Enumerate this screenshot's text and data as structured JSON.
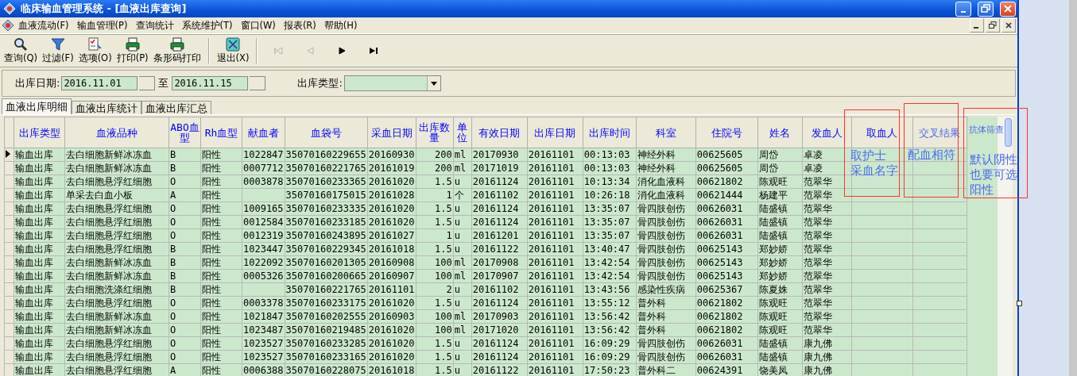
{
  "window": {
    "title": "临床输血管理系统 - [血液出库查询]"
  },
  "menu": [
    "血液流动(F)",
    "输血管理(P)",
    "查询统计",
    "系统维护(T)",
    "窗口(W)",
    "报表(R)",
    "帮助(H)"
  ],
  "toolbar": [
    {
      "kind": "search",
      "label": "查询(Q)"
    },
    {
      "kind": "filter",
      "label": "过滤(F)"
    },
    {
      "kind": "options",
      "label": "选项(O)"
    },
    {
      "kind": "print",
      "label": "打印(P)"
    },
    {
      "kind": "print",
      "label": "条形码打印"
    },
    {
      "kind": "exit",
      "label": "退出(X)"
    }
  ],
  "navigation": [
    {
      "kind": "first",
      "disabled": true
    },
    {
      "kind": "prev",
      "disabled": true
    },
    {
      "kind": "next",
      "disabled": false
    },
    {
      "kind": "last",
      "disabled": false
    }
  ],
  "filter": {
    "date_label": "出库日期:",
    "date_from": "2016.11.01",
    "date_to_label": "至",
    "date_to": "2016.11.15",
    "type_label": "出库类型:"
  },
  "tabs": [
    {
      "label": "血液出库明细",
      "selected": true
    },
    {
      "label": "血液出库统计",
      "selected": false
    },
    {
      "label": "血液出库汇总",
      "selected": false
    }
  ],
  "table": {
    "columns": [
      "出库类型",
      "血液品种",
      "ABO血型",
      "Rh血型",
      "献血者",
      "血袋号",
      "采血日期",
      "出库数量",
      "单位",
      "有效日期",
      "出库日期",
      "出库时间",
      "科室",
      "住院号",
      "姓名",
      "发血人",
      "取血人",
      "交叉结果"
    ],
    "rows": [
      {
        "selected": true,
        "cells": [
          "输血出库",
          "去白细胞新鲜冰冻血",
          "B",
          "阳性",
          "1022847",
          "35070160229655",
          "20160930",
          "200",
          "ml",
          "20170930",
          "20161101",
          "00:13:03",
          "神经外科",
          "00625605",
          "周岱",
          "卓凌"
        ]
      },
      {
        "selected": false,
        "cells": [
          "输血出库",
          "去白细胞新鲜冰冻血",
          "B",
          "阳性",
          "0007712",
          "35070160221765",
          "20161019",
          "200",
          "ml",
          "20171019",
          "20161101",
          "00:13:03",
          "神经外科",
          "00625605",
          "周岱",
          "卓凌"
        ]
      },
      {
        "selected": false,
        "cells": [
          "输血出库",
          "去白细胞悬浮红细胞",
          "O",
          "阳性",
          "0003878",
          "35070160233365",
          "20161020",
          "1.5",
          "u",
          "20161124",
          "20161101",
          "10:13:34",
          "消化血液科",
          "00621802",
          "陈观旺",
          "范翠华"
        ]
      },
      {
        "selected": false,
        "cells": [
          "输血出库",
          "单采去白血小板",
          "A",
          "阳性",
          "",
          "35070160175015",
          "20161028",
          "1",
          "个",
          "20161102",
          "20161101",
          "10:26:18",
          "消化血液科",
          "00621444",
          "杨建平",
          "范翠华"
        ]
      },
      {
        "selected": false,
        "cells": [
          "输血出库",
          "去白细胞悬浮红细胞",
          "O",
          "阳性",
          "1009165",
          "35070160233335",
          "20161020",
          "1.5",
          "u",
          "20161124",
          "20161101",
          "13:35:07",
          "骨四肢创伤",
          "00626031",
          "陆盛镇",
          "范翠华"
        ]
      },
      {
        "selected": false,
        "cells": [
          "输血出库",
          "去白细胞悬浮红细胞",
          "O",
          "阳性",
          "0012584",
          "35070160233185",
          "20161020",
          "1.5",
          "u",
          "20161124",
          "20161101",
          "13:35:07",
          "骨四肢创伤",
          "00626031",
          "陆盛镇",
          "范翠华"
        ]
      },
      {
        "selected": false,
        "cells": [
          "输血出库",
          "去白细胞悬浮红细胞",
          "O",
          "阳性",
          "0012319",
          "35070160243895",
          "20161027",
          "1",
          "u",
          "20161201",
          "20161101",
          "13:35:07",
          "骨四肢创伤",
          "00626031",
          "陆盛镇",
          "范翠华"
        ]
      },
      {
        "selected": false,
        "cells": [
          "输血出库",
          "去白细胞悬浮红细胞",
          "B",
          "阳性",
          "1023447",
          "35070160229345",
          "20161018",
          "1.5",
          "u",
          "20161122",
          "20161101",
          "13:40:47",
          "骨四肢创伤",
          "00625143",
          "郑妙娇",
          "范翠华"
        ]
      },
      {
        "selected": false,
        "cells": [
          "输血出库",
          "去白细胞新鲜冰冻血",
          "B",
          "阳性",
          "1022092",
          "35070160201305",
          "20160908",
          "100",
          "ml",
          "20170908",
          "20161101",
          "13:42:54",
          "骨四肢创伤",
          "00625143",
          "郑妙娇",
          "范翠华"
        ]
      },
      {
        "selected": false,
        "cells": [
          "输血出库",
          "去白细胞新鲜冰冻血",
          "B",
          "阳性",
          "0005326",
          "35070160200665",
          "20160907",
          "100",
          "ml",
          "20170907",
          "20161101",
          "13:42:54",
          "骨四肢创伤",
          "00625143",
          "郑妙娇",
          "范翠华"
        ]
      },
      {
        "selected": false,
        "cells": [
          "输血出库",
          "去白细胞洗涤红细胞",
          "B",
          "阳性",
          "",
          "35070160221765",
          "20161101",
          "2",
          "u",
          "20161102",
          "20161101",
          "13:43:56",
          "感染性疾病",
          "00625367",
          "陈夏姝",
          "范翠华"
        ]
      },
      {
        "selected": false,
        "cells": [
          "输血出库",
          "去白细胞悬浮红细胞",
          "O",
          "阳性",
          "0003378",
          "35070160233175",
          "20161020",
          "1.5",
          "u",
          "20161124",
          "20161101",
          "13:55:12",
          "普外科",
          "00621802",
          "陈观旺",
          "范翠华"
        ]
      },
      {
        "selected": false,
        "cells": [
          "输血出库",
          "去白细胞新鲜冰冻血",
          "O",
          "阳性",
          "1021847",
          "35070160202555",
          "20160903",
          "100",
          "ml",
          "20170903",
          "20161101",
          "13:56:42",
          "普外科",
          "00621802",
          "陈观旺",
          "范翠华"
        ]
      },
      {
        "selected": false,
        "cells": [
          "输血出库",
          "去白细胞新鲜冰冻血",
          "O",
          "阳性",
          "1023487",
          "35070160219485",
          "20161020",
          "100",
          "ml",
          "20171020",
          "20161101",
          "13:56:42",
          "普外科",
          "00621802",
          "陈观旺",
          "范翠华"
        ]
      },
      {
        "selected": false,
        "cells": [
          "输血出库",
          "去白细胞悬浮红细胞",
          "O",
          "阳性",
          "1023527",
          "35070160233285",
          "20161020",
          "1.5",
          "u",
          "20161124",
          "20161101",
          "16:09:29",
          "骨四肢创伤",
          "00626031",
          "陆盛镇",
          "康九佛"
        ]
      },
      {
        "selected": false,
        "cells": [
          "输血出库",
          "去白细胞悬浮红细胞",
          "O",
          "阳性",
          "1023527",
          "35070160233165",
          "20161020",
          "1.5",
          "u",
          "20161124",
          "20161101",
          "16:09:29",
          "骨四肢创伤",
          "00626031",
          "陆盛镇",
          "康九佛"
        ]
      },
      {
        "selected": false,
        "cells": [
          "输血出库",
          "去白细胞悬浮红细胞",
          "A",
          "阳性",
          "0006388",
          "35070160228075",
          "20161018",
          "1.5",
          "u",
          "20161122",
          "20161101",
          "17:50:23",
          "普外科二",
          "00624391",
          "饶美凤",
          "康九佛"
        ]
      }
    ]
  },
  "annotations": [
    {
      "lines": [
        "取护士",
        "采血名字"
      ]
    },
    {
      "lines": [
        "配血相符"
      ]
    },
    {
      "title": "抗体筛查",
      "lines": [
        "默认阴性",
        "也要可选",
        "阳性"
      ]
    }
  ]
}
